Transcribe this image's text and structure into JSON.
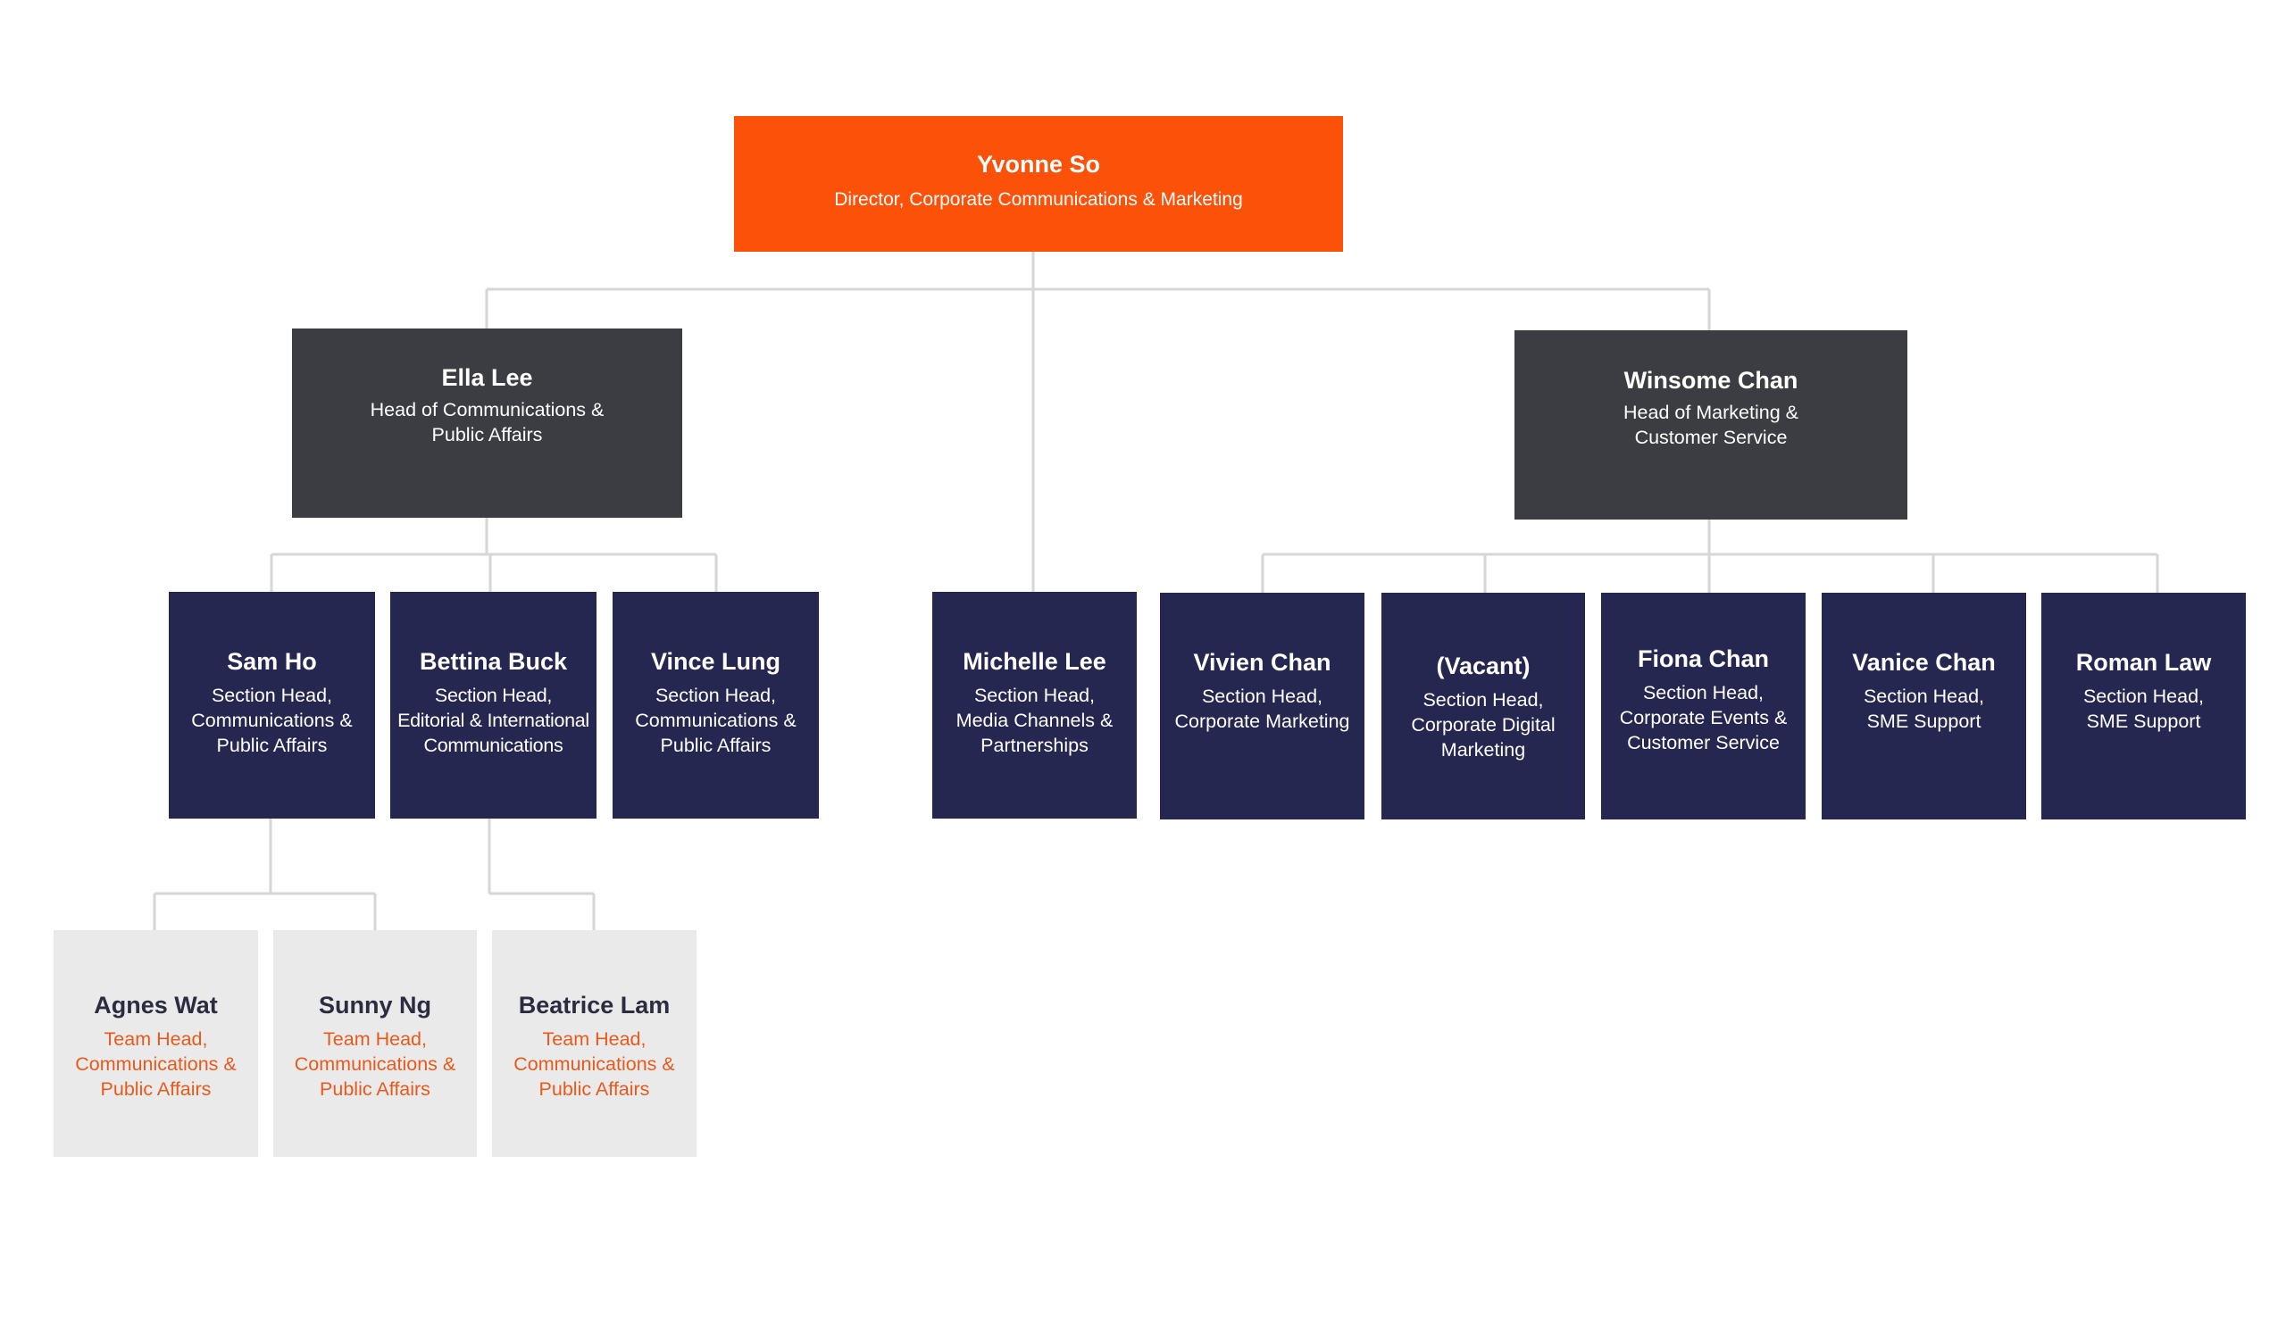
{
  "chart_title": "",
  "colors": {
    "director_fill": "#fc5108",
    "head_fill": "#3c3d42",
    "section_head_fill": "#262751",
    "team_head_fill": "#eaeaea",
    "team_head_title_text": "#e85a1c",
    "team_head_name_text": "#2b2c3f",
    "connector": "#d6d6d6"
  },
  "director": {
    "name": "Yvonne So",
    "title": "Director, Corporate Communications  & Marketing"
  },
  "heads": [
    {
      "name": "Ella Lee",
      "title": "Head of Communications &\nPublic Affairs",
      "reports_to": "Yvonne So"
    },
    {
      "name": "Winsome Chan",
      "title": "Head of Marketing &\nCustomer Service",
      "reports_to": "Yvonne So"
    }
  ],
  "section_heads": [
    {
      "name": "Sam Ho",
      "title": "Section Head,\nCommunications &\nPublic Affairs",
      "reports_to": "Ella Lee"
    },
    {
      "name": "Bettina Buck",
      "title": "Section Head,\nEditorial & International\nCommunications",
      "reports_to": "Ella Lee"
    },
    {
      "name": "Vince Lung",
      "title": "Section Head,\nCommunications &\nPublic Affairs",
      "reports_to": "Ella Lee"
    },
    {
      "name": "Michelle Lee",
      "title": "Section Head,\nMedia Channels &\nPartnerships",
      "reports_to": "Yvonne So"
    },
    {
      "name": "Vivien Chan",
      "title": "Section Head,\nCorporate Marketing",
      "reports_to": "Winsome Chan"
    },
    {
      "name": "(Vacant)",
      "title": "Section Head,\nCorporate Digital\nMarketing",
      "reports_to": "Winsome Chan"
    },
    {
      "name": "Fiona Chan",
      "title": "Section Head,\nCorporate Events &\nCustomer Service",
      "reports_to": "Winsome Chan"
    },
    {
      "name": "Vanice Chan",
      "title": "Section Head,\nSME Support",
      "reports_to": "Winsome Chan"
    },
    {
      "name": "Roman Law",
      "title": "Section Head,\nSME Support",
      "reports_to": "Winsome Chan"
    }
  ],
  "team_heads": [
    {
      "name": "Agnes Wat",
      "title": "Team Head,\nCommunications &\nPublic Affairs",
      "reports_to": "Sam Ho"
    },
    {
      "name": "Sunny Ng",
      "title": "Team Head,\nCommunications &\nPublic Affairs",
      "reports_to": "Sam Ho"
    },
    {
      "name": "Beatrice Lam",
      "title": "Team Head,\nCommunications &\nPublic Affairs",
      "reports_to": "Bettina Buck"
    }
  ]
}
